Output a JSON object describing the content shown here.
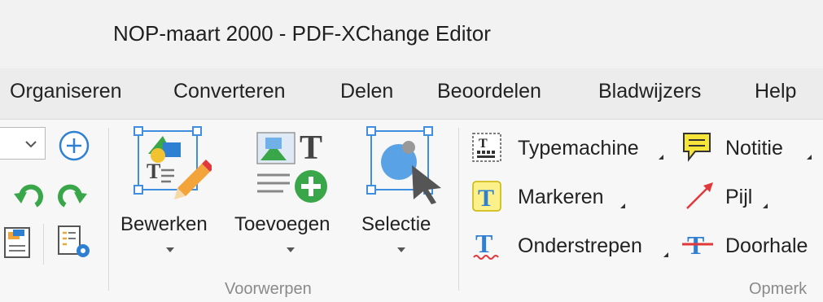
{
  "window": {
    "title": "NOP-maart 2000 - PDF-XChange Editor"
  },
  "menu": {
    "items": [
      "Organiseren",
      "Converteren",
      "Delen",
      "Beoordelen",
      "Bladwijzers",
      "Help"
    ]
  },
  "ribbon": {
    "objects_group": {
      "label": "Voorwerpen",
      "buttons": [
        "Bewerken",
        "Toevoegen",
        "Selectie"
      ]
    },
    "comments_group": {
      "label": "Opmerk",
      "tools": [
        "Typemachine",
        "Notitie",
        "Markeren",
        "Pijl",
        "Onderstrepen",
        "Doorhale"
      ]
    }
  },
  "colors": {
    "accent_blue": "#2f7fd3",
    "handle_blue": "#3f8ee0",
    "green": "#3aa64a",
    "note_yellow": "#f7e53a",
    "arrow_red": "#e0383b",
    "pencil_orange": "#f2a33a"
  }
}
